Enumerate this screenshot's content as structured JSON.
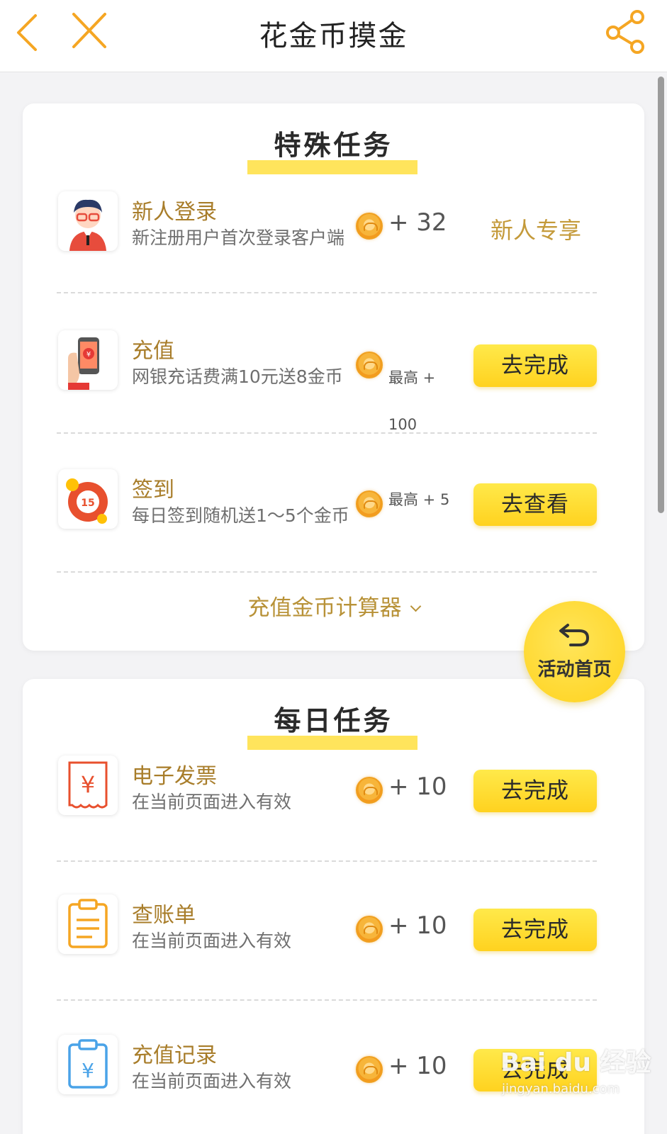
{
  "header": {
    "title": "花金币摸金",
    "back_icon": "chevron-left-icon",
    "close_icon": "close-icon",
    "share_icon": "share-icon"
  },
  "special": {
    "title": "特殊任务",
    "tasks": [
      {
        "name": "新人登录",
        "desc": "新注册用户首次登录客户端",
        "reward": "+ 32",
        "action": "新人专享",
        "icon": "avatar-icon"
      },
      {
        "name": "充值",
        "desc": "网银充话费满10元送8金币",
        "reward": "最高 + 100",
        "action": "去完成",
        "icon": "phone-recharge-icon"
      },
      {
        "name": "签到",
        "desc": "每日签到随机送1～5个金币",
        "reward": "最高 + 5",
        "action": "去查看",
        "icon": "calendar-checkin-icon"
      }
    ],
    "calculator_label": "充值金币计算器"
  },
  "daily": {
    "title": "每日任务",
    "tasks": [
      {
        "name": "电子发票",
        "desc": "在当前页面进入有效",
        "reward": "+ 10",
        "action": "去完成",
        "icon": "invoice-icon"
      },
      {
        "name": "查账单",
        "desc": "在当前页面进入有效",
        "reward": "+ 10",
        "action": "去完成",
        "icon": "clipboard-icon"
      },
      {
        "name": "充值记录",
        "desc": "在当前页面进入有效",
        "reward": "+ 10",
        "action": "去完成",
        "icon": "yen-clipboard-icon"
      }
    ]
  },
  "float_button": {
    "label": "活动首页"
  },
  "watermark": {
    "brand": "Bai du 经验",
    "url": "jingyan.baidu.com"
  },
  "colors": {
    "accent": "#f5a623",
    "button": "#ffd21f",
    "gold_text": "#a87d2a"
  }
}
